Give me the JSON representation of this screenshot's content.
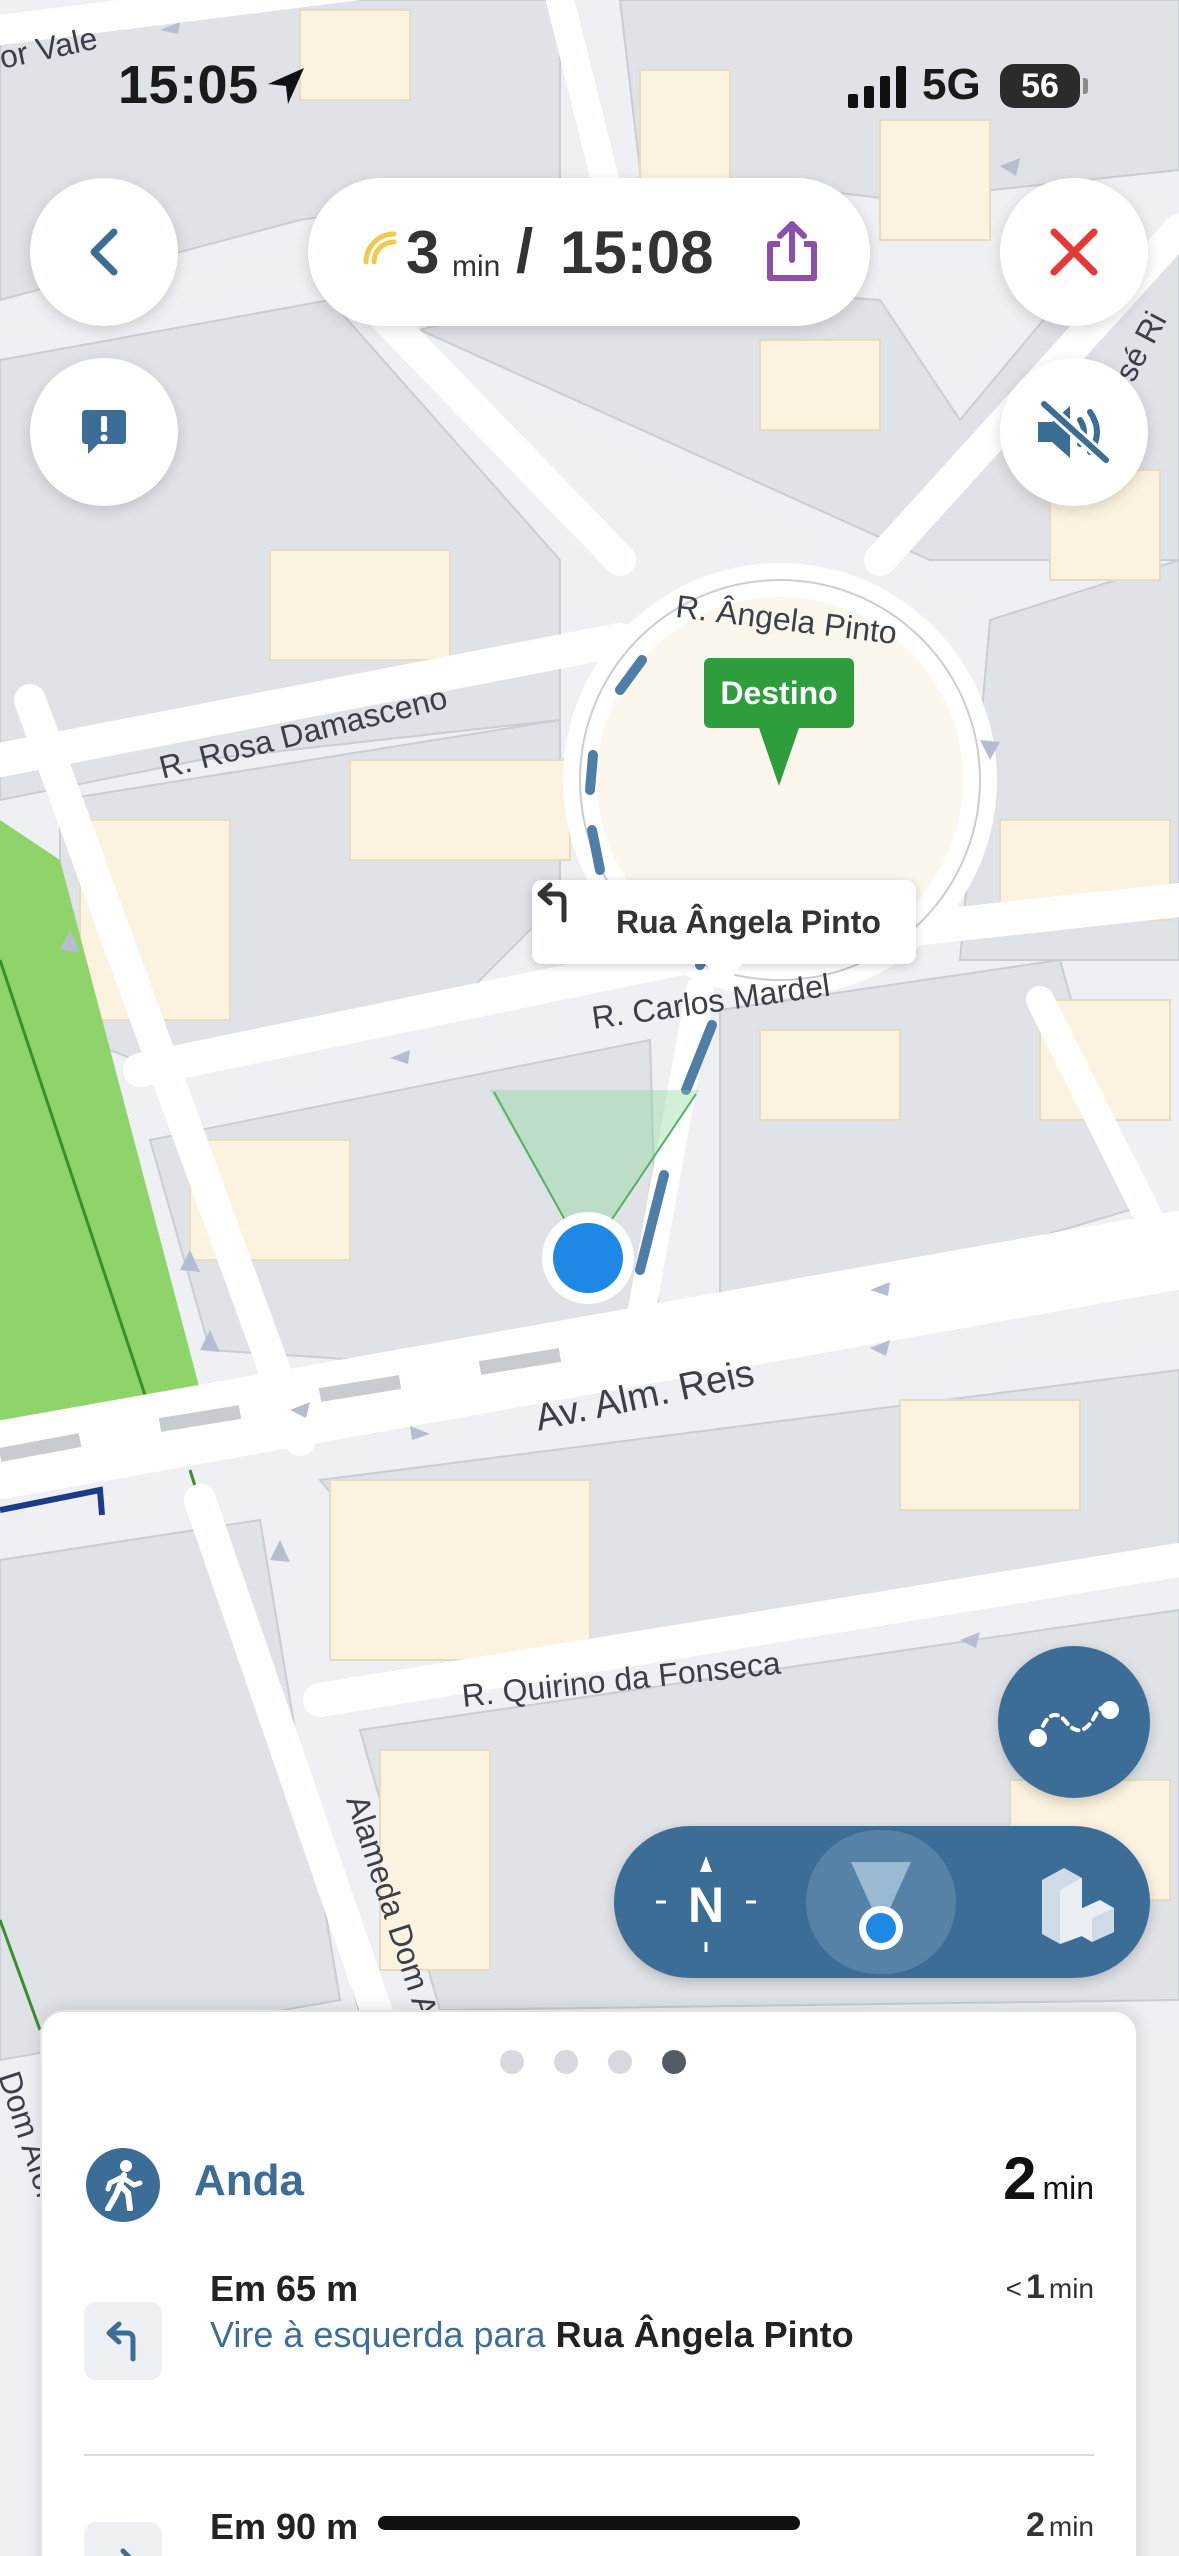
{
  "status_bar": {
    "time": "15:05",
    "network": "5G",
    "battery": "56"
  },
  "nav": {
    "back_icon": "chevron-left-icon",
    "close_icon": "close-icon",
    "report_icon": "report-issue-icon",
    "mute_icon": "speaker-muted-icon",
    "eta": {
      "minutes": "3",
      "unit": "min",
      "separator": "/",
      "arrival": "15:08"
    },
    "share_icon": "share-icon"
  },
  "map": {
    "labels": {
      "or_vale": "or Vale",
      "angela_pinto": "R. Ângela Pinto",
      "rosa_damasceno": "R. Rosa Damasceno",
      "carlos_mardel": "R. Carlos Mardel",
      "alm_reis": "Av. Alm. Reis",
      "quirino": "R. Quirino da Fonseca",
      "alameda": "Alameda Dom A",
      "jose_ri": "José Ri",
      "dom_afons": "Dom Afons"
    },
    "destination_label": "Destino",
    "turn_callout": "Rua Ângela Pinto"
  },
  "controls": {
    "route_icon": "route-overview-icon",
    "north_label": "N",
    "follow_icon": "follow-location-icon",
    "threed_icon": "3d-buildings-icon"
  },
  "sheet": {
    "page_count": 4,
    "active_page": 4,
    "mode": {
      "label": "Anda",
      "time": "2",
      "unit": "min",
      "icon": "walking-icon"
    },
    "steps": [
      {
        "distance": "Em 65 m",
        "instruction": "Vire à esquerda para",
        "street": "Rua Ângela Pinto",
        "time_prefix": "<",
        "time": "1",
        "unit": "min",
        "icon": "turn-left-icon"
      },
      {
        "distance": "Em 90 m",
        "time": "2",
        "unit": "min",
        "icon": "walk-arrive-icon"
      }
    ]
  },
  "colors": {
    "accent": "#3c6d96",
    "destination": "#2e9d3c",
    "close": "#e53935",
    "share": "#8e4fa8",
    "location": "#1e88e5",
    "park": "#8fd46a"
  }
}
